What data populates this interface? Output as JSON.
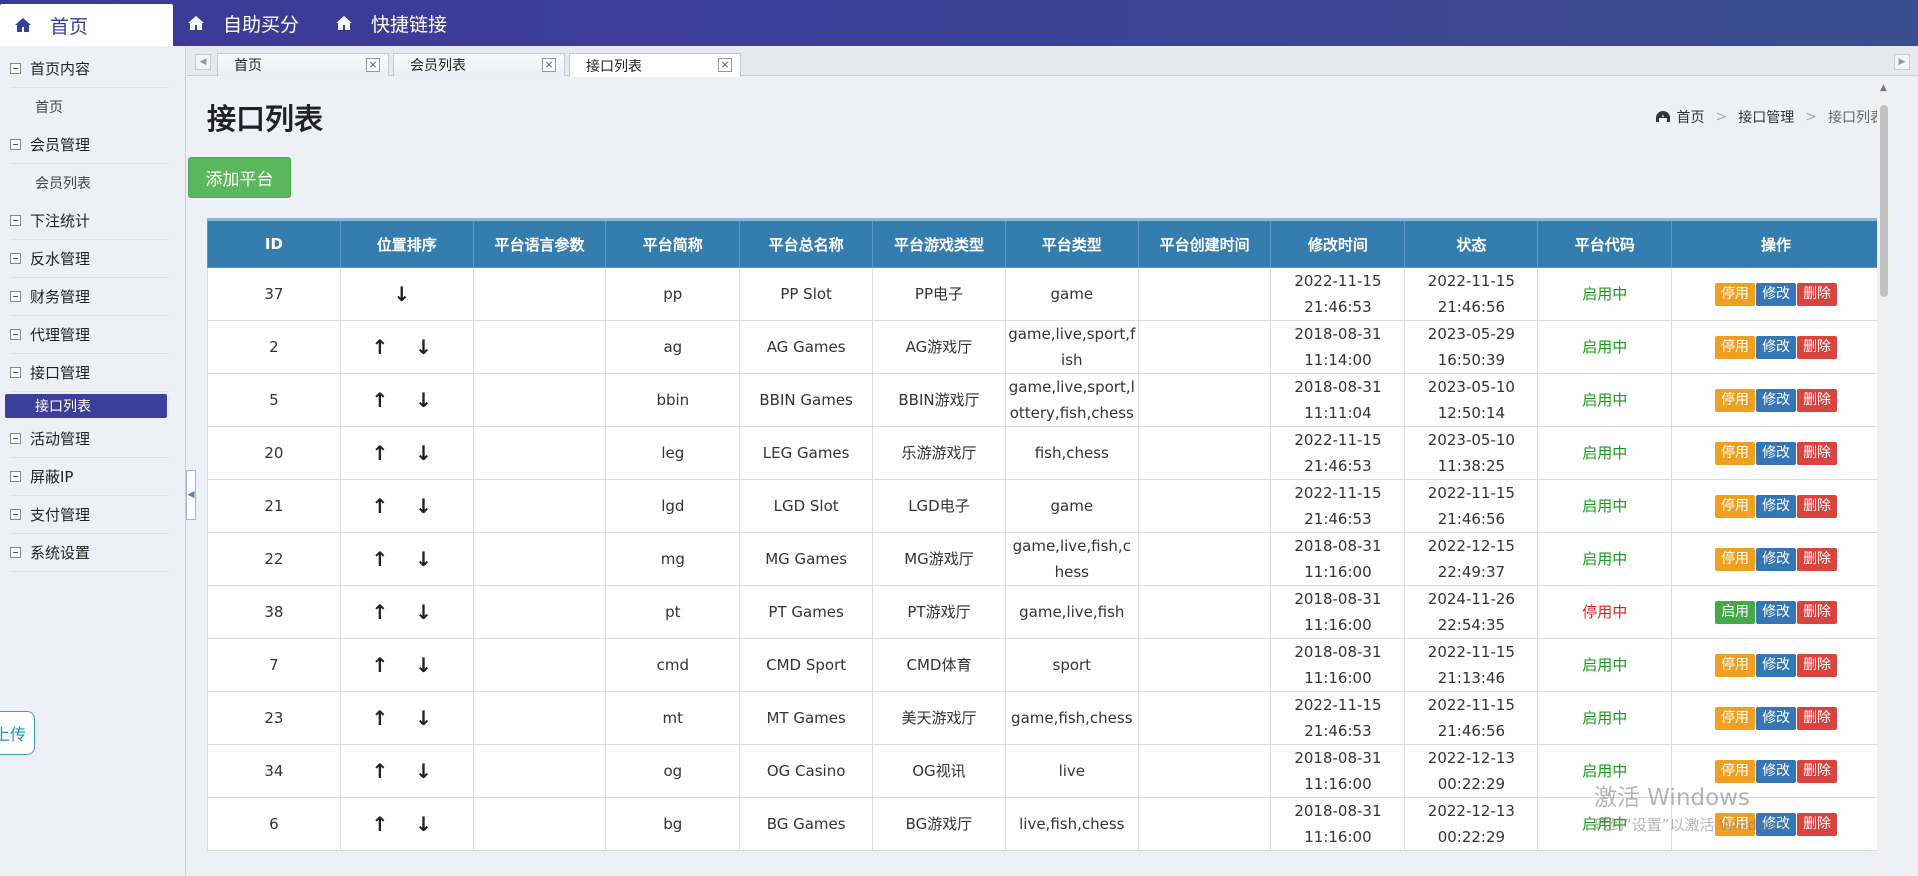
{
  "topnav": [
    {
      "label": "首页",
      "icon": "home-icon",
      "active": true
    },
    {
      "label": "自助买分",
      "icon": "home-icon",
      "active": false
    },
    {
      "label": "快捷链接",
      "icon": "home-icon",
      "active": false
    }
  ],
  "sidebar": {
    "groups": [
      {
        "label": "首页内容",
        "subs": [
          {
            "label": "首页",
            "active": false
          }
        ]
      },
      {
        "label": "会员管理",
        "subs": [
          {
            "label": "会员列表",
            "active": false
          }
        ]
      },
      {
        "label": "下注统计",
        "subs": []
      },
      {
        "label": "反水管理",
        "subs": []
      },
      {
        "label": "财务管理",
        "subs": []
      },
      {
        "label": "代理管理",
        "subs": []
      },
      {
        "label": "接口管理",
        "subs": [
          {
            "label": "接口列表",
            "active": true
          }
        ]
      },
      {
        "label": "活动管理",
        "subs": []
      },
      {
        "label": "屏蔽IP",
        "subs": []
      },
      {
        "label": "支付管理",
        "subs": []
      },
      {
        "label": "系统设置",
        "subs": []
      }
    ],
    "upload_label": "上传"
  },
  "tabs": [
    {
      "label": "首页",
      "active": false
    },
    {
      "label": "会员列表",
      "active": false
    },
    {
      "label": "接口列表",
      "active": true
    }
  ],
  "page": {
    "title": "接口列表",
    "breadcrumb": [
      "首页",
      "接口管理",
      "接口列表"
    ],
    "add_button": "添加平台"
  },
  "table": {
    "headers": [
      "ID",
      "位置排序",
      "平台语言参数",
      "平台简称",
      "平台总名称",
      "平台游戏类型",
      "平台类型",
      "平台创建时间",
      "修改时间",
      "状态",
      "平台代码",
      "操作"
    ],
    "rows": [
      {
        "id": "37",
        "sort": "↓",
        "lang": "",
        "short": "pp",
        "name": "PP Slot",
        "game_type": "PP电子",
        "ptype": "game",
        "created": "",
        "modified": "2022-11-15 21:46:53",
        "status": "2022-11-15 21:46:56",
        "code": "启用中",
        "on": true,
        "toggle": "停用"
      },
      {
        "id": "2",
        "sort": "↑ ↓",
        "lang": "",
        "short": "ag",
        "name": "AG Games",
        "game_type": "AG游戏厅",
        "ptype": "game,live,sport,fish",
        "created": "",
        "modified": "2018-08-31 11:14:00",
        "status": "2023-05-29 16:50:39",
        "code": "启用中",
        "on": true,
        "toggle": "停用"
      },
      {
        "id": "5",
        "sort": "↑ ↓",
        "lang": "",
        "short": "bbin",
        "name": "BBIN Games",
        "game_type": "BBIN游戏厅",
        "ptype": "game,live,sport,lottery,fish,chess",
        "created": "",
        "modified": "2018-08-31 11:11:04",
        "status": "2023-05-10 12:50:14",
        "code": "启用中",
        "on": true,
        "toggle": "停用"
      },
      {
        "id": "20",
        "sort": "↑ ↓",
        "lang": "",
        "short": "leg",
        "name": "LEG Games",
        "game_type": "乐游游戏厅",
        "ptype": "fish,chess",
        "created": "",
        "modified": "2022-11-15 21:46:53",
        "status": "2023-05-10 11:38:25",
        "code": "启用中",
        "on": true,
        "toggle": "停用"
      },
      {
        "id": "21",
        "sort": "↑ ↓",
        "lang": "",
        "short": "lgd",
        "name": "LGD Slot",
        "game_type": "LGD电子",
        "ptype": "game",
        "created": "",
        "modified": "2022-11-15 21:46:53",
        "status": "2022-11-15 21:46:56",
        "code": "启用中",
        "on": true,
        "toggle": "停用"
      },
      {
        "id": "22",
        "sort": "↑ ↓",
        "lang": "",
        "short": "mg",
        "name": "MG Games",
        "game_type": "MG游戏厅",
        "ptype": "game,live,fish,chess",
        "created": "",
        "modified": "2018-08-31 11:16:00",
        "status": "2022-12-15 22:49:37",
        "code": "启用中",
        "on": true,
        "toggle": "停用"
      },
      {
        "id": "38",
        "sort": "↑ ↓",
        "lang": "",
        "short": "pt",
        "name": "PT Games",
        "game_type": "PT游戏厅",
        "ptype": "game,live,fish",
        "created": "",
        "modified": "2018-08-31 11:16:00",
        "status": "2024-11-26 22:54:35",
        "code": "停用中",
        "on": false,
        "toggle": "启用"
      },
      {
        "id": "7",
        "sort": "↑ ↓",
        "lang": "",
        "short": "cmd",
        "name": "CMD Sport",
        "game_type": "CMD体育",
        "ptype": "sport",
        "created": "",
        "modified": "2018-08-31 11:16:00",
        "status": "2022-11-15 21:13:46",
        "code": "启用中",
        "on": true,
        "toggle": "停用"
      },
      {
        "id": "23",
        "sort": "↑ ↓",
        "lang": "",
        "short": "mt",
        "name": "MT Games",
        "game_type": "美天游戏厅",
        "ptype": "game,fish,chess",
        "created": "",
        "modified": "2022-11-15 21:46:53",
        "status": "2022-11-15 21:46:56",
        "code": "启用中",
        "on": true,
        "toggle": "停用"
      },
      {
        "id": "34",
        "sort": "↑ ↓",
        "lang": "",
        "short": "og",
        "name": "OG Casino",
        "game_type": "OG视讯",
        "ptype": "live",
        "created": "",
        "modified": "2018-08-31 11:16:00",
        "status": "2022-12-13 00:22:29",
        "code": "启用中",
        "on": true,
        "toggle": "停用"
      },
      {
        "id": "6",
        "sort": "↑ ↓",
        "lang": "",
        "short": "bg",
        "name": "BG Games",
        "game_type": "BG游戏厅",
        "ptype": "live,fish,chess",
        "created": "",
        "modified": "2018-08-31 11:16:00",
        "status": "2022-12-13 00:22:29",
        "code": "启用中",
        "on": true,
        "toggle": "停用"
      }
    ],
    "ops": {
      "edit": "修改",
      "del": "删除"
    }
  },
  "watermark": {
    "line1": "激活 Windows",
    "line2": "转到“设置”以激活 Windows。"
  },
  "colors": {
    "brand": "#3b3f9b",
    "header": "#357caf",
    "on": "#1a9a1a",
    "off": "#e02020",
    "stop": "#f0a020",
    "start": "#42ab48",
    "edit": "#3776b6",
    "del": "#d9453e"
  }
}
